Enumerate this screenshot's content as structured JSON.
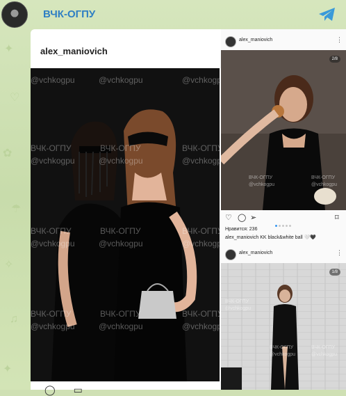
{
  "header": {
    "channel_title": "ВЧК-ОГПУ",
    "share_icon": "telegram-share-icon",
    "avatar_icon": "channel-avatar-icon"
  },
  "post": {
    "username": "alex_maniovich",
    "watermarks": [
      "@vchkogpu",
      "ВЧК-ОГПУ"
    ]
  },
  "instagram": {
    "post1": {
      "username": "alex_maniovich",
      "counter": "2/8",
      "likes": "Нравится: 236",
      "caption": "alex_maniovich KK black&white ball 🤍🖤"
    },
    "post2": {
      "username": "alex_maniovich",
      "counter": "1/8"
    }
  },
  "colors": {
    "accent": "#2f7fc4",
    "wallpaper": "#cfe0b4",
    "instagram_dot_active": "#3897f0"
  }
}
